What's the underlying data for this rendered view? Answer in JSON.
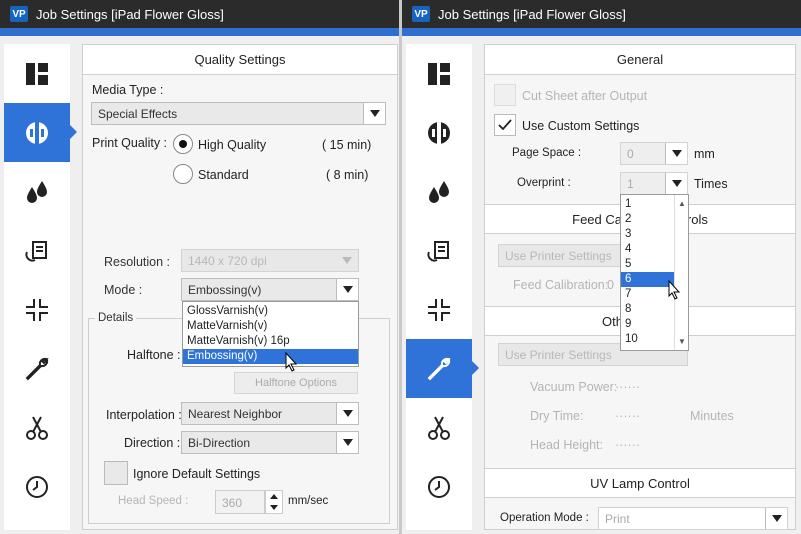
{
  "left": {
    "title": "Job Settings [iPad Flower Gloss]",
    "quality_section": "Quality Settings",
    "media_type_label": "Media Type :",
    "media_type_value": "Special Effects",
    "print_quality_label": "Print Quality :",
    "high_quality": "High Quality",
    "high_quality_time": "( 15 min)",
    "standard": "Standard",
    "standard_time": "( 8 min)",
    "resolution_label": "Resolution :",
    "resolution_value": "1440 x 720 dpi",
    "mode_label": "Mode :",
    "mode_value": "Embossing(v)",
    "mode_options": [
      "GlossVarnish(v)",
      "MatteVarnish(v)",
      "MatteVarnish(v) 16p",
      "Embossing(v)"
    ],
    "mode_selected_index": 3,
    "details_label": "Details",
    "halftone_label": "Halftone :",
    "halftone_button": "Halftone Options",
    "interpolation_label": "Interpolation :",
    "interpolation_value": "Nearest Neighbor",
    "direction_label": "Direction :",
    "direction_value": "Bi-Direction",
    "ignore_default": "Ignore Default Settings",
    "head_speed_label": "Head Speed :",
    "head_speed_value": "360",
    "head_speed_unit": "mm/sec"
  },
  "right": {
    "title": "Job Settings [iPad Flower Gloss]",
    "general_section": "General",
    "cut_sheet": "Cut Sheet after Output",
    "use_custom": "Use Custom Settings",
    "page_space_label": "Page Space :",
    "page_space_value": "0",
    "page_space_unit": "mm",
    "overprint_label": "Overprint :",
    "overprint_value": "1",
    "overprint_unit": "Times",
    "overprint_options": [
      "1",
      "2",
      "3",
      "4",
      "5",
      "6",
      "7",
      "8",
      "9",
      "10"
    ],
    "overprint_selected_index": 5,
    "feed_section_left": "Feed Cal",
    "feed_section_right": "rols",
    "use_printer_settings_1": "Use Printer Settings",
    "feed_calibration_label": "Feed Calibration:",
    "feed_calibration_value": "0",
    "other_section": "Oth",
    "use_printer_settings_2": "Use Printer Settings",
    "vacuum_power_label": "Vacuum Power:",
    "vacuum_power_value": "······",
    "dry_time_label": "Dry Time:",
    "dry_time_value": "······",
    "dry_time_unit": "Minutes",
    "head_height_label": "Head Height:",
    "head_height_value": "······",
    "uv_section": "UV Lamp Control",
    "operation_mode_label": "Operation Mode :",
    "operation_mode_value": "Print"
  },
  "nav_icons": [
    "layout-icon",
    "quality-icon",
    "ink-drops-icon",
    "media-feed-icon",
    "scale-icon",
    "wrench-icon",
    "scissors-icon",
    "clock-icon"
  ],
  "accent_color": "#2f73d8"
}
